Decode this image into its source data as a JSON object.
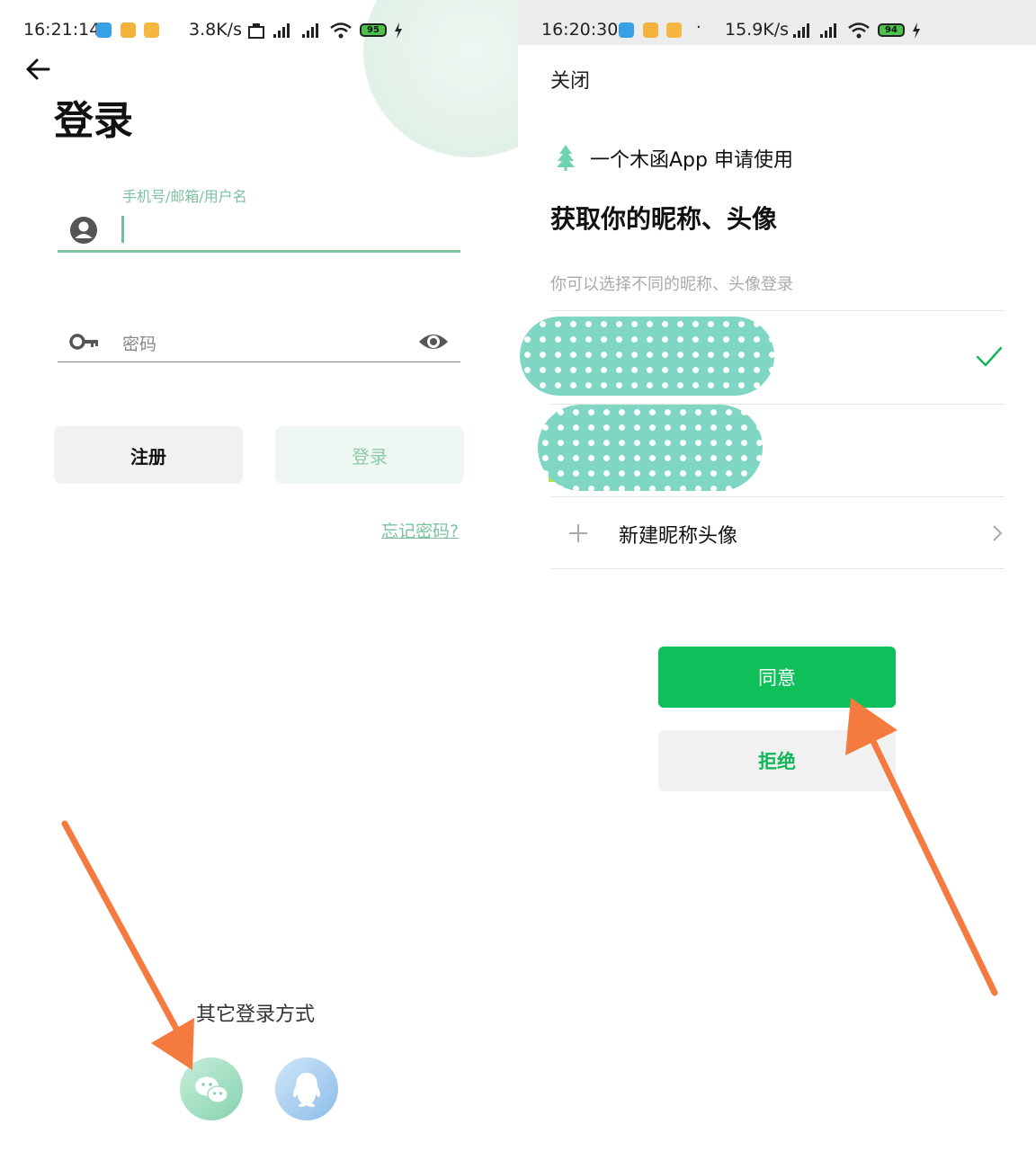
{
  "accent": "#7cc29f",
  "agree_color": "#0fbf5a",
  "annotation_arrow_color": "#f47a3f",
  "left": {
    "status": {
      "time": "16:21:14",
      "speed": "3.8K/s",
      "battery": "95"
    },
    "title": "登录",
    "username": {
      "hint": "手机号/邮箱/用户名",
      "value": ""
    },
    "password": {
      "placeholder": "密码"
    },
    "register_label": "注册",
    "login_label": "登录",
    "forgot_label": "忘记密码?",
    "other_login_label": "其它登录方式",
    "icons": [
      "back-arrow-icon",
      "user-icon",
      "key-icon",
      "eye-icon",
      "wechat-icon",
      "qq-icon"
    ]
  },
  "right": {
    "status": {
      "time": "16:20:30",
      "speed": "15.9K/s",
      "battery": "94"
    },
    "close_label": "关闭",
    "app_request": "一个木函App  申请使用",
    "title": "获取你的昵称、头像",
    "subtitle": "你可以选择不同的昵称、头像登录",
    "profiles": [
      {
        "selected": true
      },
      {
        "selected": false
      }
    ],
    "new_profile_label": "新建昵称头像",
    "agree_label": "同意",
    "refuse_label": "拒绝",
    "icons": [
      "tree-icon",
      "check-icon",
      "plus-icon",
      "chevron-right-icon"
    ]
  }
}
